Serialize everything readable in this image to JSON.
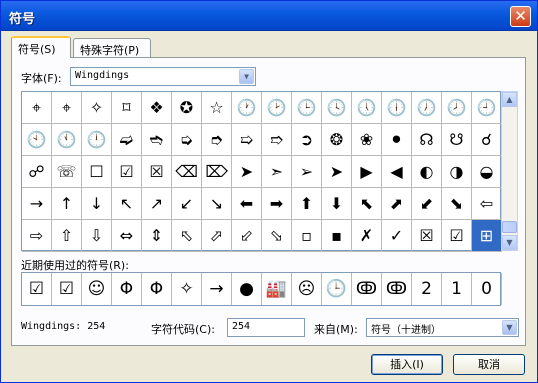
{
  "window": {
    "title": "符号",
    "close_glyph": "✕"
  },
  "tabs": [
    {
      "label": "符号(S)"
    },
    {
      "label": "特殊字符(P)"
    }
  ],
  "font_select": {
    "label": "字体(F):",
    "value": "Wingdings"
  },
  "symbols": [
    "⌖",
    "⌖",
    "✧",
    "⌑",
    "❖",
    "✪",
    "☆",
    "🕐",
    "🕑",
    "🕒",
    "🕓",
    "🕔",
    "🕕",
    "🕖",
    "🕗",
    "🕘",
    "🕙",
    "🕚",
    "🕛",
    "➫",
    "➬",
    "➭",
    "➮",
    "➯",
    "➱",
    "➲",
    "❂",
    "❀",
    "⚫",
    "☊",
    "☋",
    "☌",
    "☍",
    "☏",
    "☐",
    "☑",
    "☒",
    "⌫",
    "⌦",
    "➤",
    "➣",
    "➢",
    "➤",
    "▶",
    "◀",
    "◐",
    "◑",
    "◒",
    "→",
    "↑",
    "↓",
    "↖",
    "↗",
    "↙",
    "↘",
    "⬅",
    "➡",
    "⬆",
    "⬇",
    "⬉",
    "⬈",
    "⬋",
    "⬊",
    "⇦",
    "⇨",
    "⇧",
    "⇩",
    "⇔",
    "⇕",
    "⬁",
    "⬀",
    "⬃",
    "⬂",
    "▫",
    "▪",
    "✗",
    "✓",
    "☒",
    "☑",
    "⊞"
  ],
  "selected_index": 79,
  "recent": {
    "label": "近期使用过的符号(R):",
    "items": [
      "☑",
      "☑",
      "☺",
      "Φ",
      "Φ",
      "✧",
      "→",
      "●",
      "🏭",
      "☹",
      "🕒",
      "ↂ",
      "ↂ",
      "2",
      "1",
      "0"
    ]
  },
  "status": {
    "font_code_label": "Wingdings: 254"
  },
  "char_code": {
    "label": "字符代码(C):",
    "value": "254"
  },
  "from": {
    "label": "来自(M):",
    "value": "符号（十进制）"
  },
  "buttons": {
    "insert": "插入(I)",
    "cancel": "取消"
  }
}
